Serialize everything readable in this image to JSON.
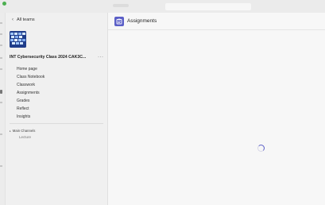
{
  "back": {
    "label": "All teams",
    "icon": "chevron-left-icon"
  },
  "team": {
    "name": "INT Cybersecurity Class 2024 CAK3C...",
    "more_icon": "more-icon",
    "more_label": "···"
  },
  "nav": {
    "items": [
      {
        "label": "Home page"
      },
      {
        "label": "Class Notebook"
      },
      {
        "label": "Classwork"
      },
      {
        "label": "Assignments"
      },
      {
        "label": "Grades"
      },
      {
        "label": "Reflect"
      },
      {
        "label": "Insights"
      }
    ]
  },
  "channels": {
    "header": "Main Channels",
    "toggle": "▸",
    "items": [
      {
        "label": "Lecture"
      }
    ]
  },
  "main": {
    "title": "Assignments",
    "app_icon": "assignments-icon",
    "loading_icon": "loading-spinner-icon"
  },
  "colors": {
    "accent": "#5b5fc7",
    "status": "#4caf50",
    "team_image": "#1f3d8a"
  }
}
